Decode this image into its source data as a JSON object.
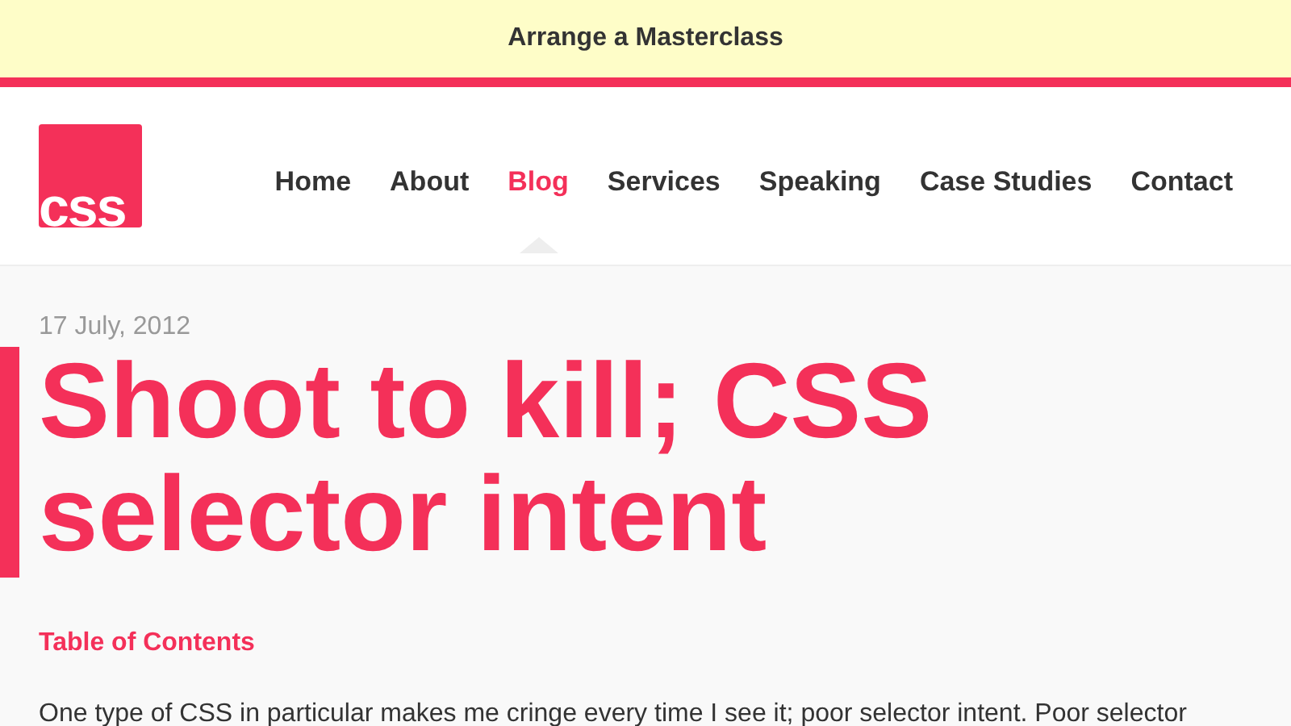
{
  "banner": {
    "text": "Arrange a Masterclass"
  },
  "logo": {
    "text": "css"
  },
  "nav": [
    {
      "label": "Home",
      "selected": false
    },
    {
      "label": "About",
      "selected": false
    },
    {
      "label": "Blog",
      "selected": true
    },
    {
      "label": "Services",
      "selected": false
    },
    {
      "label": "Speaking",
      "selected": false
    },
    {
      "label": "Case Studies",
      "selected": false
    },
    {
      "label": "Contact",
      "selected": false
    }
  ],
  "article": {
    "date": "17 July, 2012",
    "title": "Shoot to kill; CSS selector intent",
    "toc": "Table of Contents",
    "paragraph": "One type of CSS in particular makes me cringe every time I see it; poor selector intent. Poor selector"
  }
}
